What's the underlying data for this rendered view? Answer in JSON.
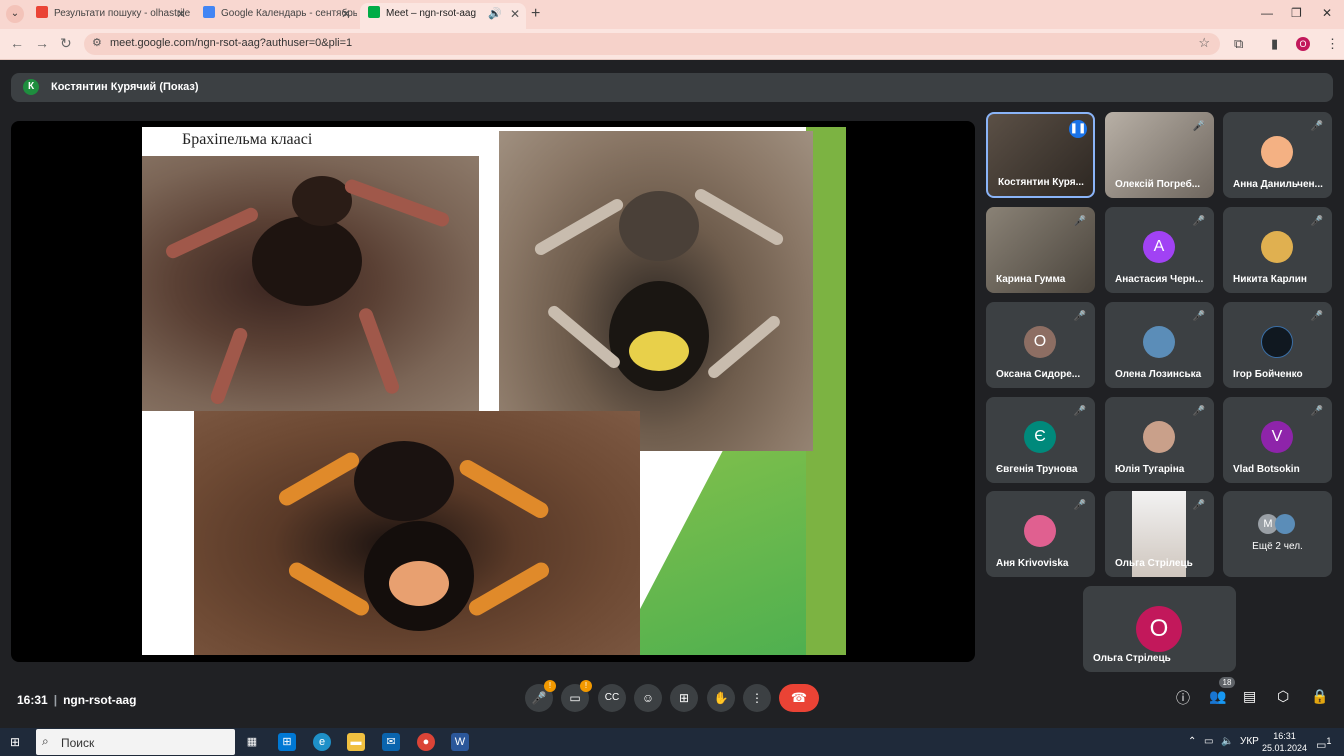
{
  "browser": {
    "tabs": [
      {
        "label": "Результати пошуку - olhastrile",
        "favicon": "gmail-icon"
      },
      {
        "label": "Google Календарь - сентябрь",
        "favicon": "calendar-icon"
      },
      {
        "label": "Meet – ngn-rsot-aag",
        "favicon": "meet-icon"
      }
    ],
    "url": "meet.google.com/ngn-rsot-aag?authuser=0&pli=1",
    "profile_letter": "O"
  },
  "meet": {
    "presenter": {
      "initial": "К",
      "label": "Костянтин Курячий (Показ)"
    },
    "slide": {
      "title": "Брахіпельма клаасі"
    },
    "participants": [
      {
        "name": "Костянтин Куря...",
        "type": "video",
        "speaking": true
      },
      {
        "name": "Олексій Погреб...",
        "type": "video",
        "muted": true
      },
      {
        "name": "Анна Данильчен...",
        "type": "photo",
        "muted": true,
        "color": "#f4b183"
      },
      {
        "name": "Карина Гумма",
        "type": "video",
        "muted": true
      },
      {
        "name": "Анастасия Черн...",
        "type": "letter",
        "letter": "А",
        "color": "#a142f4",
        "muted": true
      },
      {
        "name": "Никита Карлин",
        "type": "photo",
        "muted": true,
        "color": "#e0b050"
      },
      {
        "name": "Оксана Сидоре...",
        "type": "letter",
        "letter": "О",
        "color": "#8d6e63",
        "muted": true
      },
      {
        "name": "Олена Лозинська",
        "type": "photo",
        "muted": true,
        "color": "#5b8db8"
      },
      {
        "name": "Ігор Бойченко",
        "type": "photo",
        "muted": true,
        "color": "#101820"
      },
      {
        "name": "Євгенія Трунова",
        "type": "letter",
        "letter": "Є",
        "color": "#00897b",
        "muted": true
      },
      {
        "name": "Юлія Тугаріна",
        "type": "photo",
        "muted": true,
        "color": "#c9a08a"
      },
      {
        "name": "Vlad Botsokin",
        "type": "letter",
        "letter": "V",
        "color": "#8e24aa",
        "muted": true
      },
      {
        "name": "Аня Krivoviska",
        "type": "photo",
        "muted": true,
        "color": "#e06090"
      },
      {
        "name": "Ольга Стрілець",
        "type": "video",
        "muted": true
      },
      {
        "name": "Ещё 2 чел.",
        "type": "more"
      }
    ],
    "self_tile": {
      "letter": "О",
      "name": "Ольга Стрілець",
      "color": "#c2185b"
    },
    "more_avatar_letter": "М",
    "time": "16:31",
    "meeting_code": "ngn-rsot-aag",
    "participant_count": "18"
  },
  "taskbar": {
    "search_placeholder": "Поиск",
    "lang": "УКР",
    "time": "16:31",
    "date": "25.01.2024",
    "notif_count": "1"
  }
}
